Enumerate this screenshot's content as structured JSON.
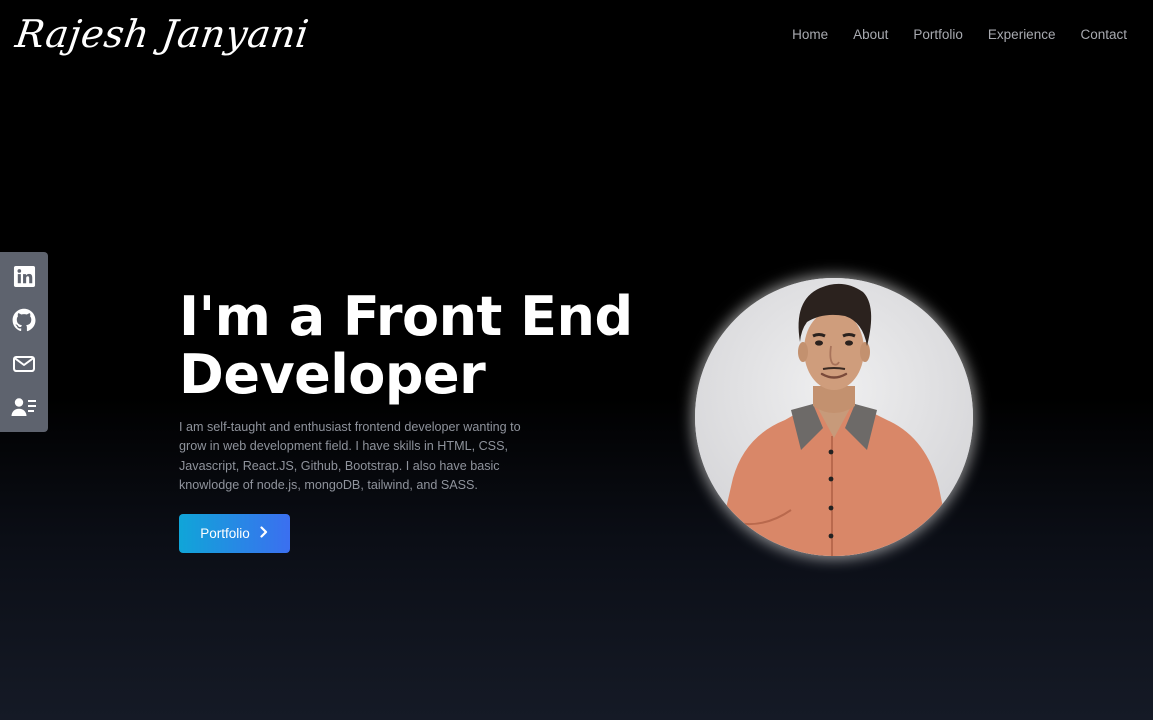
{
  "header": {
    "logo_text": "Rajesh Janyani",
    "nav": [
      "Home",
      "About",
      "Portfolio",
      "Experience",
      "Contact"
    ]
  },
  "social": {
    "icons": [
      "linkedin-icon",
      "github-icon",
      "mail-icon",
      "resume-icon"
    ],
    "panel_color": "#5e636e"
  },
  "hero": {
    "headline_line1": "I'm a Front End",
    "headline_line2": "Developer",
    "description": "I am self-taught and enthusiast frontend developer wanting to grow in web development field. I have skills in HTML, CSS, Javascript, React.JS, Github, Bootstrap. I also have basic knowlodge of node.js, mongoDB, tailwind, and SASS.",
    "button_label": "Portfolio",
    "button_icon": "chevron-right-icon",
    "button_gradient": [
      "#10a5d8",
      "#3b6ff0"
    ]
  },
  "profile": {
    "shirt_color": "#d98768"
  }
}
